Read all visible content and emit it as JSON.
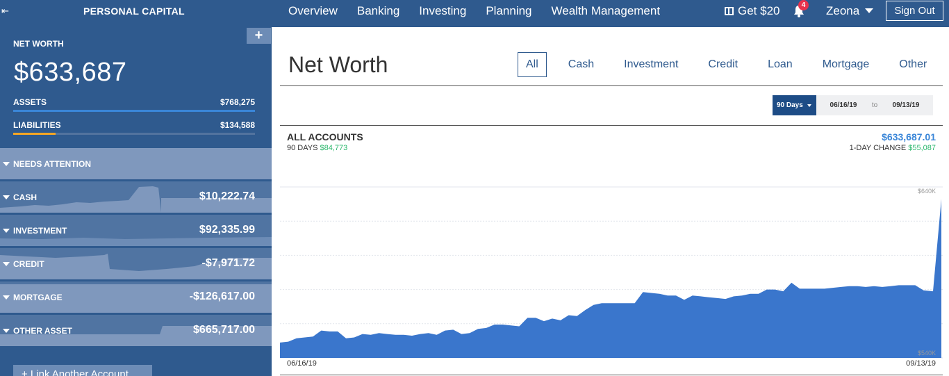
{
  "topbar": {
    "brand": "PERSONAL CAPITAL",
    "collapse_icon": "collapse-left-icon",
    "nav": [
      "Overview",
      "Banking",
      "Investing",
      "Planning",
      "Wealth Management"
    ],
    "get_offer": "Get $20",
    "notification_count": "4",
    "user": "Zeona",
    "sign_out": "Sign Out"
  },
  "sidebar": {
    "add_label": "+",
    "net_worth_label": "NET WORTH",
    "net_worth_value": "$633,687",
    "assets_label": "ASSETS",
    "assets_value": "$768,275",
    "liabilities_label": "LIABILITIES",
    "liabilities_value": "$134,588",
    "colors": {
      "assets": "#3a86d8",
      "liabilities": "#f5a623"
    },
    "needs_attention": "NEEDS ATTENTION",
    "accounts": [
      {
        "label": "CASH",
        "value": "$10,222.74"
      },
      {
        "label": "INVESTMENT",
        "value": "$92,335.99"
      },
      {
        "label": "CREDIT",
        "value": "-$7,971.72"
      },
      {
        "label": "MORTGAGE",
        "value": "-$126,617.00"
      },
      {
        "label": "OTHER ASSET",
        "value": "$665,717.00"
      }
    ],
    "link_account": "+ Link Another Account"
  },
  "main": {
    "title": "Net Worth",
    "filters": [
      "All",
      "Cash",
      "Investment",
      "Credit",
      "Loan",
      "Mortgage",
      "Other"
    ],
    "active_filter": "All",
    "range_button": "90 Days",
    "date_from": "06/16/19",
    "date_sep": "to",
    "date_to": "09/13/19",
    "accounts_title": "ALL ACCOUNTS",
    "days_label": "90 DAYS",
    "days_change": "$84,773",
    "total": "$633,687.01",
    "day_change_label": "1-DAY CHANGE",
    "day_change": "$55,087"
  },
  "chart_data": {
    "type": "area",
    "title": "",
    "xlabel": "",
    "ylabel": "",
    "x_start_label": "06/16/19",
    "x_end_label": "09/13/19",
    "y_top_label": "$640K",
    "y_bottom_label": "$540K",
    "ylim": [
      540000,
      640000
    ],
    "color": "#3a76cc",
    "values": [
      549000,
      549500,
      551500,
      552000,
      552500,
      556000,
      555500,
      555500,
      551500,
      552000,
      554000,
      553500,
      554500,
      554000,
      553500,
      553500,
      553000,
      554000,
      554500,
      553500,
      556000,
      556500,
      554000,
      554500,
      557000,
      557500,
      559500,
      559500,
      559000,
      558500,
      563500,
      563500,
      561500,
      563000,
      562000,
      565000,
      564500,
      568000,
      571000,
      572000,
      572000,
      572000,
      572000,
      572000,
      578500,
      578000,
      577500,
      576500,
      576500,
      574000,
      576500,
      576000,
      575500,
      575000,
      574500,
      576000,
      576500,
      577500,
      577500,
      580000,
      580000,
      579000,
      584000,
      580500,
      580500,
      580500,
      580500,
      581000,
      581500,
      582000,
      582000,
      581500,
      582000,
      581500,
      582000,
      582500,
      582500,
      582500,
      579500,
      579000,
      633000
    ]
  }
}
